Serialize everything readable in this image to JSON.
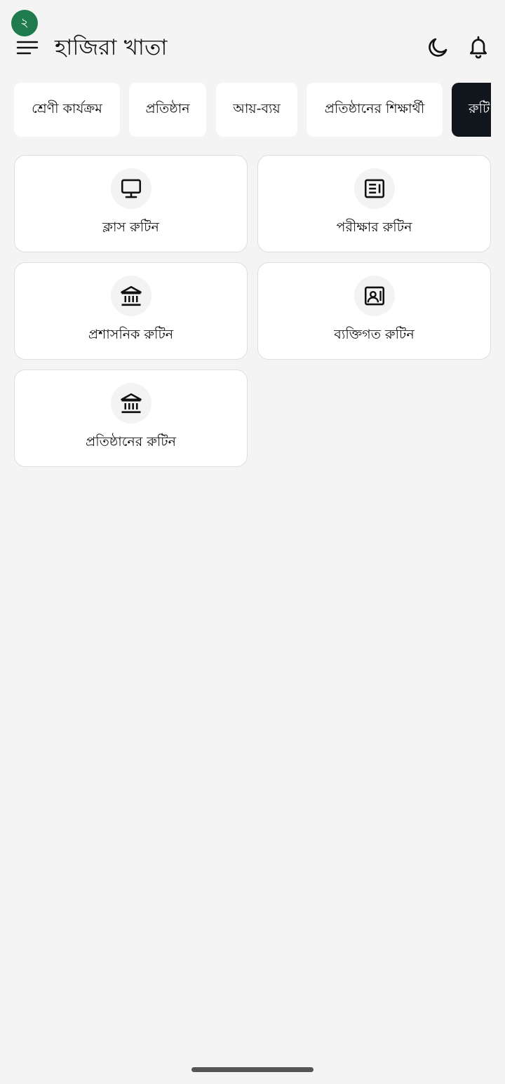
{
  "header": {
    "badge": "২",
    "title": "হাজিরা খাতা",
    "menu_icon": "menu-icon",
    "dark_mode_icon": "moon-icon",
    "notification_icon": "bell-icon"
  },
  "tabs": [
    {
      "label": "শ্রেণী কার্যক্রম"
    },
    {
      "label": "প্রতিষ্ঠান"
    },
    {
      "label": "আয়-ব্যয়"
    },
    {
      "label": "প্রতিষ্ঠানের শিক্ষার্থী"
    },
    {
      "label": "রুটি"
    }
  ],
  "cards": [
    {
      "label": "ক্লাস রুটিন",
      "icon": "monitor-icon"
    },
    {
      "label": "পরীক্ষার রুটিন",
      "icon": "newspaper-icon"
    },
    {
      "label": "প্রশাসনিক রুটিন",
      "icon": "institution-icon"
    },
    {
      "label": "ব্যক্তিগত রুটিন",
      "icon": "id-card-icon"
    },
    {
      "label": "প্রতিষ্ঠানের রুটিন",
      "icon": "institution-icon"
    }
  ],
  "colors": {
    "badge": "#1f7a4d",
    "active_tab": "#11161c",
    "background": "#f4f4f4"
  }
}
